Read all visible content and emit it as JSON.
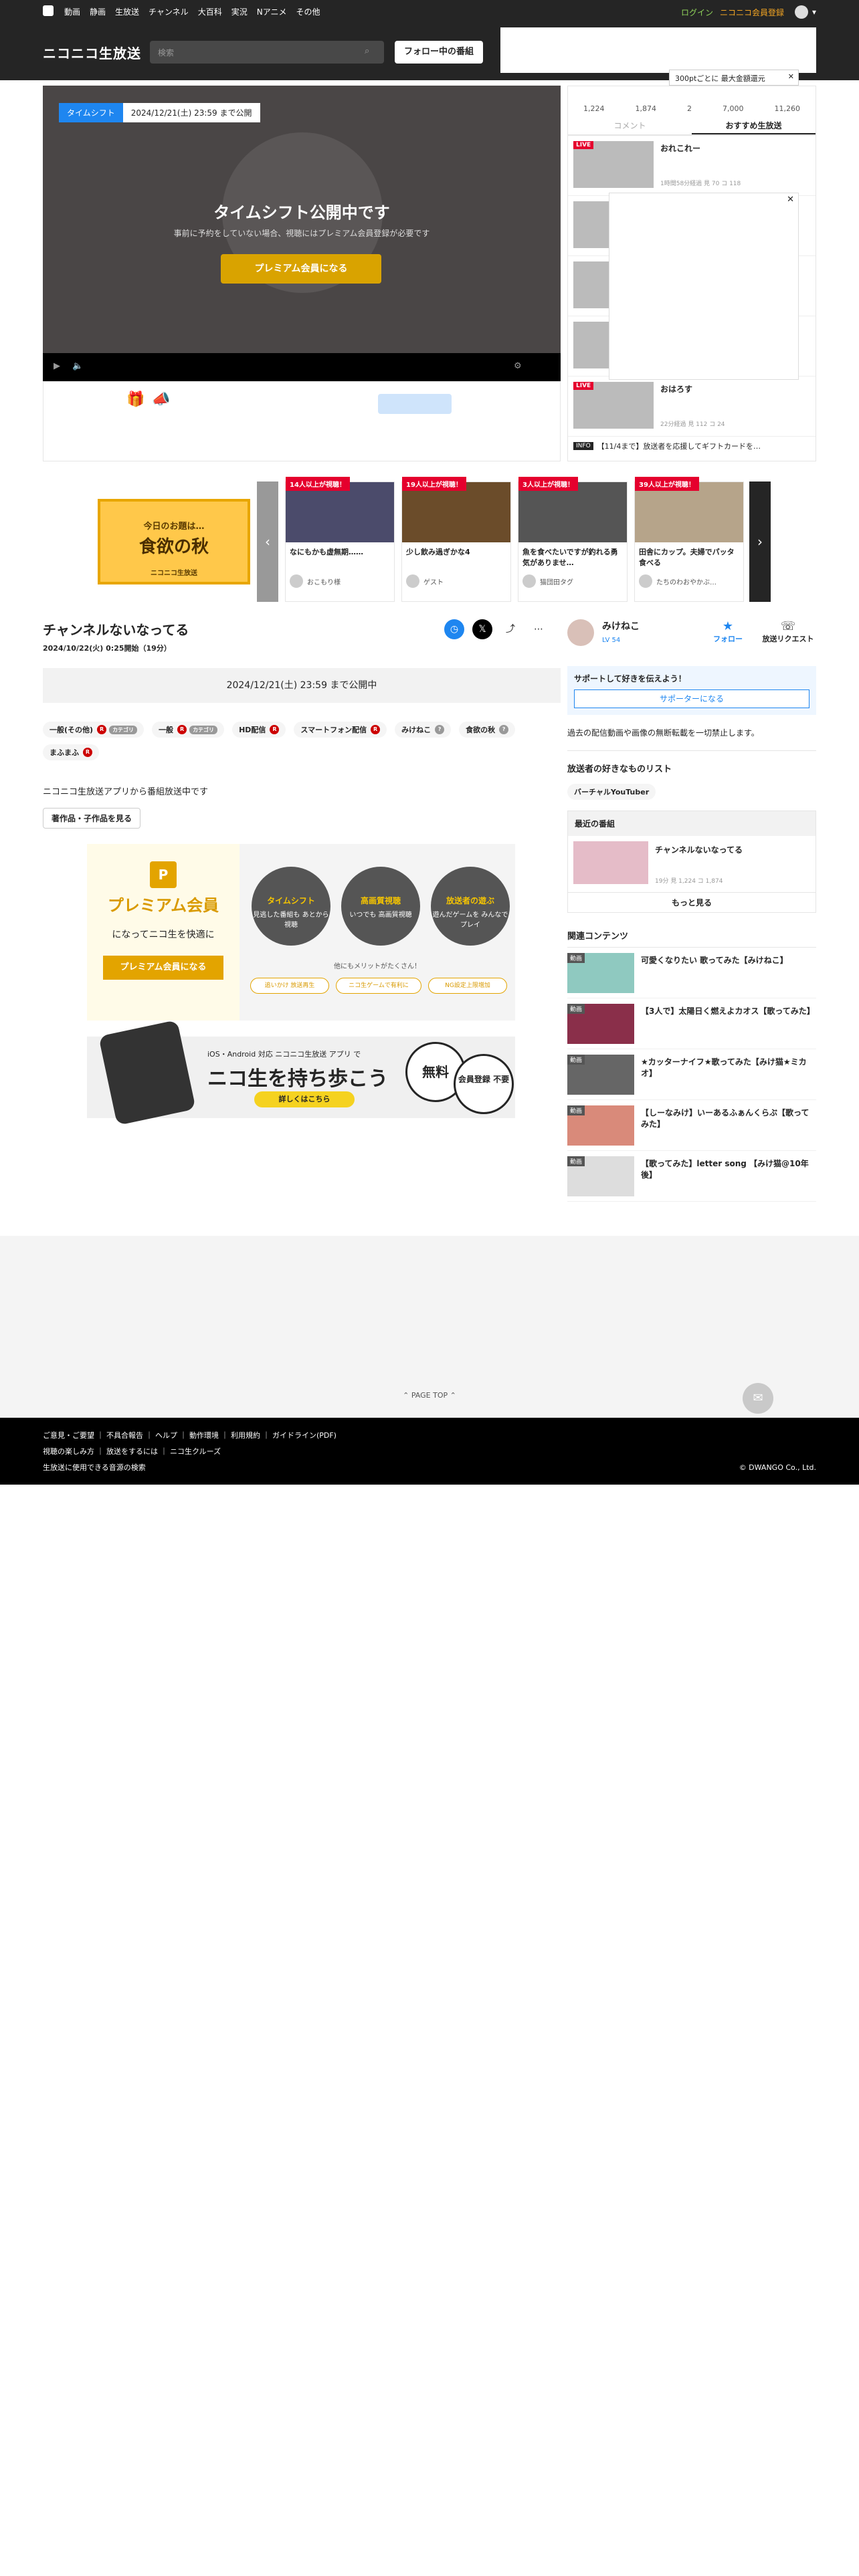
{
  "topbar": {
    "nav": [
      "動画",
      "静画",
      "生放送",
      "チャンネル",
      "大百科",
      "実況",
      "Nアニメ",
      "その他"
    ],
    "login": "ログイン",
    "register": "ニコニコ会員登録"
  },
  "header": {
    "logo": "ニコニコ生放送",
    "search_placeholder": "検索",
    "follow_button": "フォロー中の番組"
  },
  "player": {
    "ts_label": "タイムシフト",
    "ts_date": "2024/12/21(土) 23:59 まで公開",
    "title": "タイムシフト公開中です",
    "subtitle": "事前に予約をしていない場合、視聴にはプレミアム会員登録が必要です",
    "premium_button": "プレミアム会員になる"
  },
  "popup": {
    "text": "300ptごとに 最大金額還元"
  },
  "side": {
    "stats": [
      "1,224",
      "1,874",
      "2",
      "7,000",
      "11,260"
    ],
    "tabs": [
      "コメント",
      "おすすめ生放送"
    ],
    "items": [
      {
        "badge": "LIVE",
        "title": "おれこれー",
        "meta": "1時間58分経過  見 70  コ 118"
      },
      {
        "badge": "LIVE",
        "title": "おはろす",
        "meta": "22分経過  見 112  コ 24"
      }
    ],
    "info_badge": "INFO",
    "info": "【11/4まで】放送者を応援してギフトカードを…"
  },
  "carousel": {
    "promo_top": "今日のお題は…",
    "promo_main": "食欲の秋",
    "promo_sub": "ニコニコ生放送",
    "cards": [
      {
        "badge": "14人以上が視聴！",
        "title": "なにもかも虚無期……",
        "user": "おこもり様"
      },
      {
        "badge": "19人以上が視聴！",
        "title": "少し飲み過ぎかな4",
        "user": "ゲスト"
      },
      {
        "badge": "3人以上が視聴！",
        "title": "魚を食べたいですが釣れる勇気がありませ…",
        "user": "猫団田タグ"
      },
      {
        "badge": "39人以上が視聴！",
        "title": "田舎にカップ。夫婦でパッタ食べる",
        "user": "たちのわおやかぶ…"
      }
    ]
  },
  "main": {
    "title": "チャンネルないなってる",
    "date": "2024/10/22(火) 0:25開始（19分）",
    "notice": "2024/12/21(土) 23:59 まで公開中",
    "tags": [
      "一般(その他)",
      "一般",
      "HD配信",
      "スマートフォン配信",
      "みけねこ",
      "食欲の秋",
      "まふまふ"
    ],
    "description": "ニコニコ生放送アプリから番組放送中です",
    "work_button": "著作品・子作品を見る"
  },
  "premium_banner": {
    "title": "プレミアム会員",
    "desc": "になってニコ生を快適に",
    "button": "プレミアム会員になる",
    "features": [
      {
        "head": "タイムシフト",
        "body": "見逃した番組も あとから視聴"
      },
      {
        "head": "高画質視聴",
        "body": "いつでも 高画質視聴"
      },
      {
        "head": "放送者の遊ぶ",
        "body": "遊んだゲームを みんなでプレイ"
      }
    ],
    "more": "他にもメリットがたくさん！",
    "chips": [
      "追いかけ 放送再生",
      "ニコ生ゲームで有利に",
      "NG設定上限増加"
    ]
  },
  "app_banner": {
    "small": "iOS・Android 対応 ニコニコ生放送 アプリ で",
    "big": "ニコ生を持ち歩こう",
    "button": "詳しくはこちら",
    "bubble1": "無料",
    "bubble2": "会員登録 不要"
  },
  "right": {
    "user": "みけねこ",
    "level": "LV 54",
    "follow": "フォロー",
    "request": "放送リクエスト",
    "support_head": "サポートして好きを伝えよう！",
    "support_btn": "サポーターになる",
    "text": "過去の配信動画や画像の無断転載を一切禁止します。",
    "list_head": "放送者の好きなものリスト",
    "list_tag": "バーチャルYouTuber",
    "recent_head": "最近の番組",
    "recent_item": {
      "title": "チャンネルないなってる",
      "meta": "19分  見 1,224  コ 1,874"
    },
    "recent_more": "もっと見る",
    "related_head": "関連コンテンツ",
    "related": [
      "可愛くなりたい 歌ってみた【みけねこ】",
      "【3人で】太陽日く燃えよカオス【歌ってみた】",
      "★カッターナイフ★歌ってみた【みけ猫★ミカオ】",
      "【しーなみけ】いーあるふぁんくらぶ【歌ってみた】",
      "【歌ってみた】letter song 【みけ猫@10年後】"
    ],
    "related_badge": "動画"
  },
  "footer": {
    "pagetop": "PAGE TOP",
    "row1": "ご意見・ご要望 ｜ 不具合報告 ｜ ヘルプ ｜ 動作環境 ｜ 利用規約 ｜ ガイドライン(PDF)",
    "row2": "視聴の楽しみ方 ｜ 放送をするには ｜ ニコ生クルーズ",
    "row3": "生放送に使用できる音源の検索",
    "copyright": "© DWANGO Co., Ltd."
  }
}
